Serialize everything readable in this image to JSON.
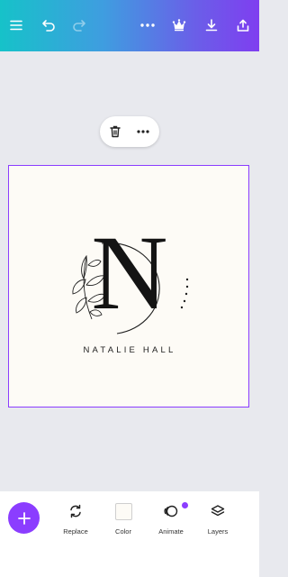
{
  "colors": {
    "accent": "#8b3dff",
    "topbar_gradient": [
      "#16c2c9",
      "#7f3ef0"
    ],
    "canvas_bg": "#fdfbf6",
    "workspace_bg": "#e8e9ee"
  },
  "topbar": {
    "icons": [
      "menu-icon",
      "undo-icon",
      "redo-icon",
      "more-icon",
      "crown-icon",
      "download-icon",
      "share-icon"
    ]
  },
  "context_menu": {
    "icons": [
      "trash-icon",
      "more-icon"
    ]
  },
  "design": {
    "monogram_letter": "N",
    "name_text": "NATALIE HALL"
  },
  "bottom_toolbar": {
    "add_icon": "plus-icon",
    "tools": [
      {
        "label": "Replace",
        "icon": "replace-icon"
      },
      {
        "label": "Color",
        "icon": "color-swatch-icon"
      },
      {
        "label": "Animate",
        "icon": "animate-icon"
      },
      {
        "label": "Layers",
        "icon": "layers-icon"
      }
    ]
  }
}
